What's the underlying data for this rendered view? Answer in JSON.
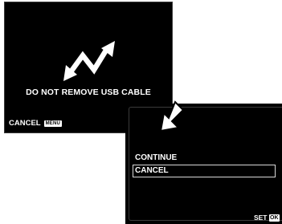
{
  "usb_screen": {
    "icon": "usb-connection-icon",
    "warning": "DO NOT REMOVE USB CABLE",
    "cancel_label": "CANCEL",
    "cancel_key": "MENU"
  },
  "transition": {
    "icon": "arrow-down-left-icon"
  },
  "menu_screen": {
    "items": [
      {
        "label": "CONTINUE",
        "selected": false
      },
      {
        "label": "CANCEL",
        "selected": true
      }
    ],
    "set_label": "SET",
    "set_key": "OK"
  },
  "colors": {
    "screen_background": "#000000",
    "text": "#ffffff",
    "selection_border": "#d8d8d8",
    "page_background": "#ffffff"
  }
}
